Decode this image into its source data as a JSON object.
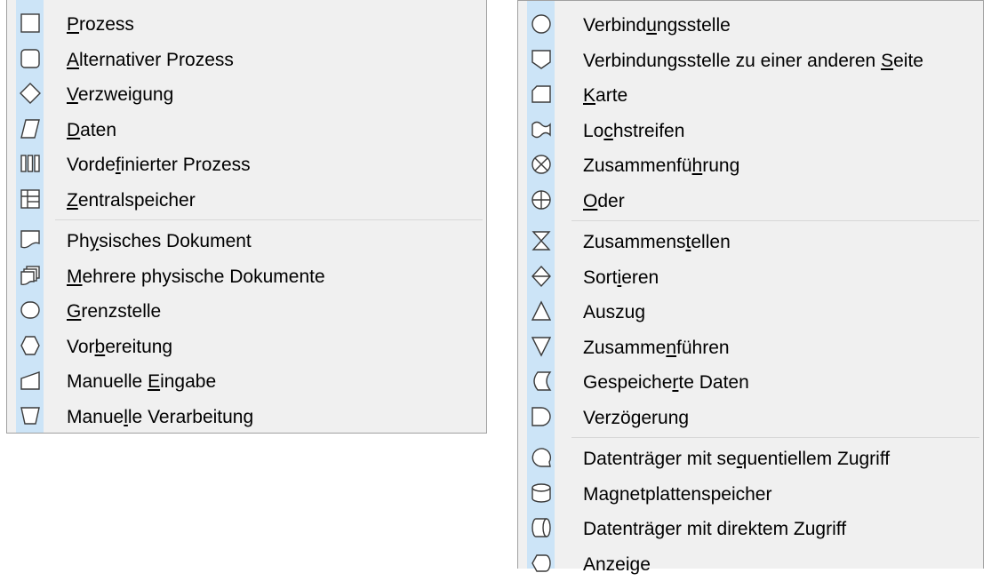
{
  "left_menu": {
    "groups": [
      [
        {
          "icon": "process-icon",
          "pre": "",
          "key": "P",
          "post": "rozess"
        },
        {
          "icon": "alternative-process-icon",
          "pre": "",
          "key": "A",
          "post": "lternativer Prozess"
        },
        {
          "icon": "decision-icon",
          "pre": "",
          "key": "V",
          "post": "erzweigung"
        },
        {
          "icon": "data-icon",
          "pre": "",
          "key": "D",
          "post": "aten"
        },
        {
          "icon": "predefined-process-icon",
          "pre": "Vorde",
          "key": "f",
          "post": "inierter Prozess"
        },
        {
          "icon": "internal-storage-icon",
          "pre": "",
          "key": "Z",
          "post": "entralspeicher"
        }
      ],
      [
        {
          "icon": "document-icon",
          "pre": "Ph",
          "key": "y",
          "post": "sisches Dokument"
        },
        {
          "icon": "multidocument-icon",
          "pre": "",
          "key": "M",
          "post": "ehrere physische Dokumente"
        },
        {
          "icon": "terminator-icon",
          "pre": "",
          "key": "G",
          "post": "renzstelle"
        },
        {
          "icon": "preparation-icon",
          "pre": "Vor",
          "key": "b",
          "post": "ereitung"
        },
        {
          "icon": "manual-input-icon",
          "pre": "Manuelle ",
          "key": "E",
          "post": "ingabe"
        },
        {
          "icon": "manual-operation-icon",
          "pre": "Manue",
          "key": "l",
          "post": "le Verarbeitung"
        }
      ]
    ]
  },
  "right_menu": {
    "groups": [
      [
        {
          "icon": "connector-icon",
          "pre": "Verbind",
          "key": "u",
          "post": "ngsstelle"
        },
        {
          "icon": "off-page-connector-icon",
          "pre": "Verbindungsstelle zu einer anderen ",
          "key": "S",
          "post": "eite"
        },
        {
          "icon": "card-icon",
          "pre": "",
          "key": "K",
          "post": "arte"
        },
        {
          "icon": "punched-tape-icon",
          "pre": "Lo",
          "key": "c",
          "post": "hstreifen"
        },
        {
          "icon": "summing-junction-icon",
          "pre": "Zusammenfü",
          "key": "h",
          "post": "rung"
        },
        {
          "icon": "or-icon",
          "pre": "",
          "key": "O",
          "post": "der"
        }
      ],
      [
        {
          "icon": "collate-icon",
          "pre": "Zusammens",
          "key": "t",
          "post": "ellen"
        },
        {
          "icon": "sort-icon",
          "pre": "Sort",
          "key": "i",
          "post": "eren"
        },
        {
          "icon": "extract-icon",
          "pre": "Auszug",
          "key": "",
          "post": ""
        },
        {
          "icon": "merge-icon",
          "pre": "Zusamme",
          "key": "n",
          "post": "führen"
        },
        {
          "icon": "stored-data-icon",
          "pre": "Gespeiche",
          "key": "r",
          "post": "te Daten"
        },
        {
          "icon": "delay-icon",
          "pre": "Verzögerung",
          "key": "",
          "post": ""
        }
      ],
      [
        {
          "icon": "sequential-access-icon",
          "pre": "Datenträger mit se",
          "key": "q",
          "post": "uentiellem Zugriff"
        },
        {
          "icon": "magnetic-disk-icon",
          "pre": "Magnetplattenspeicher",
          "key": "",
          "post": ""
        },
        {
          "icon": "direct-access-icon",
          "pre": "Datenträger mit direktem Zugriff",
          "key": "",
          "post": ""
        },
        {
          "icon": "display-icon",
          "pre": "Anzeige",
          "key": "",
          "post": ""
        }
      ]
    ]
  }
}
